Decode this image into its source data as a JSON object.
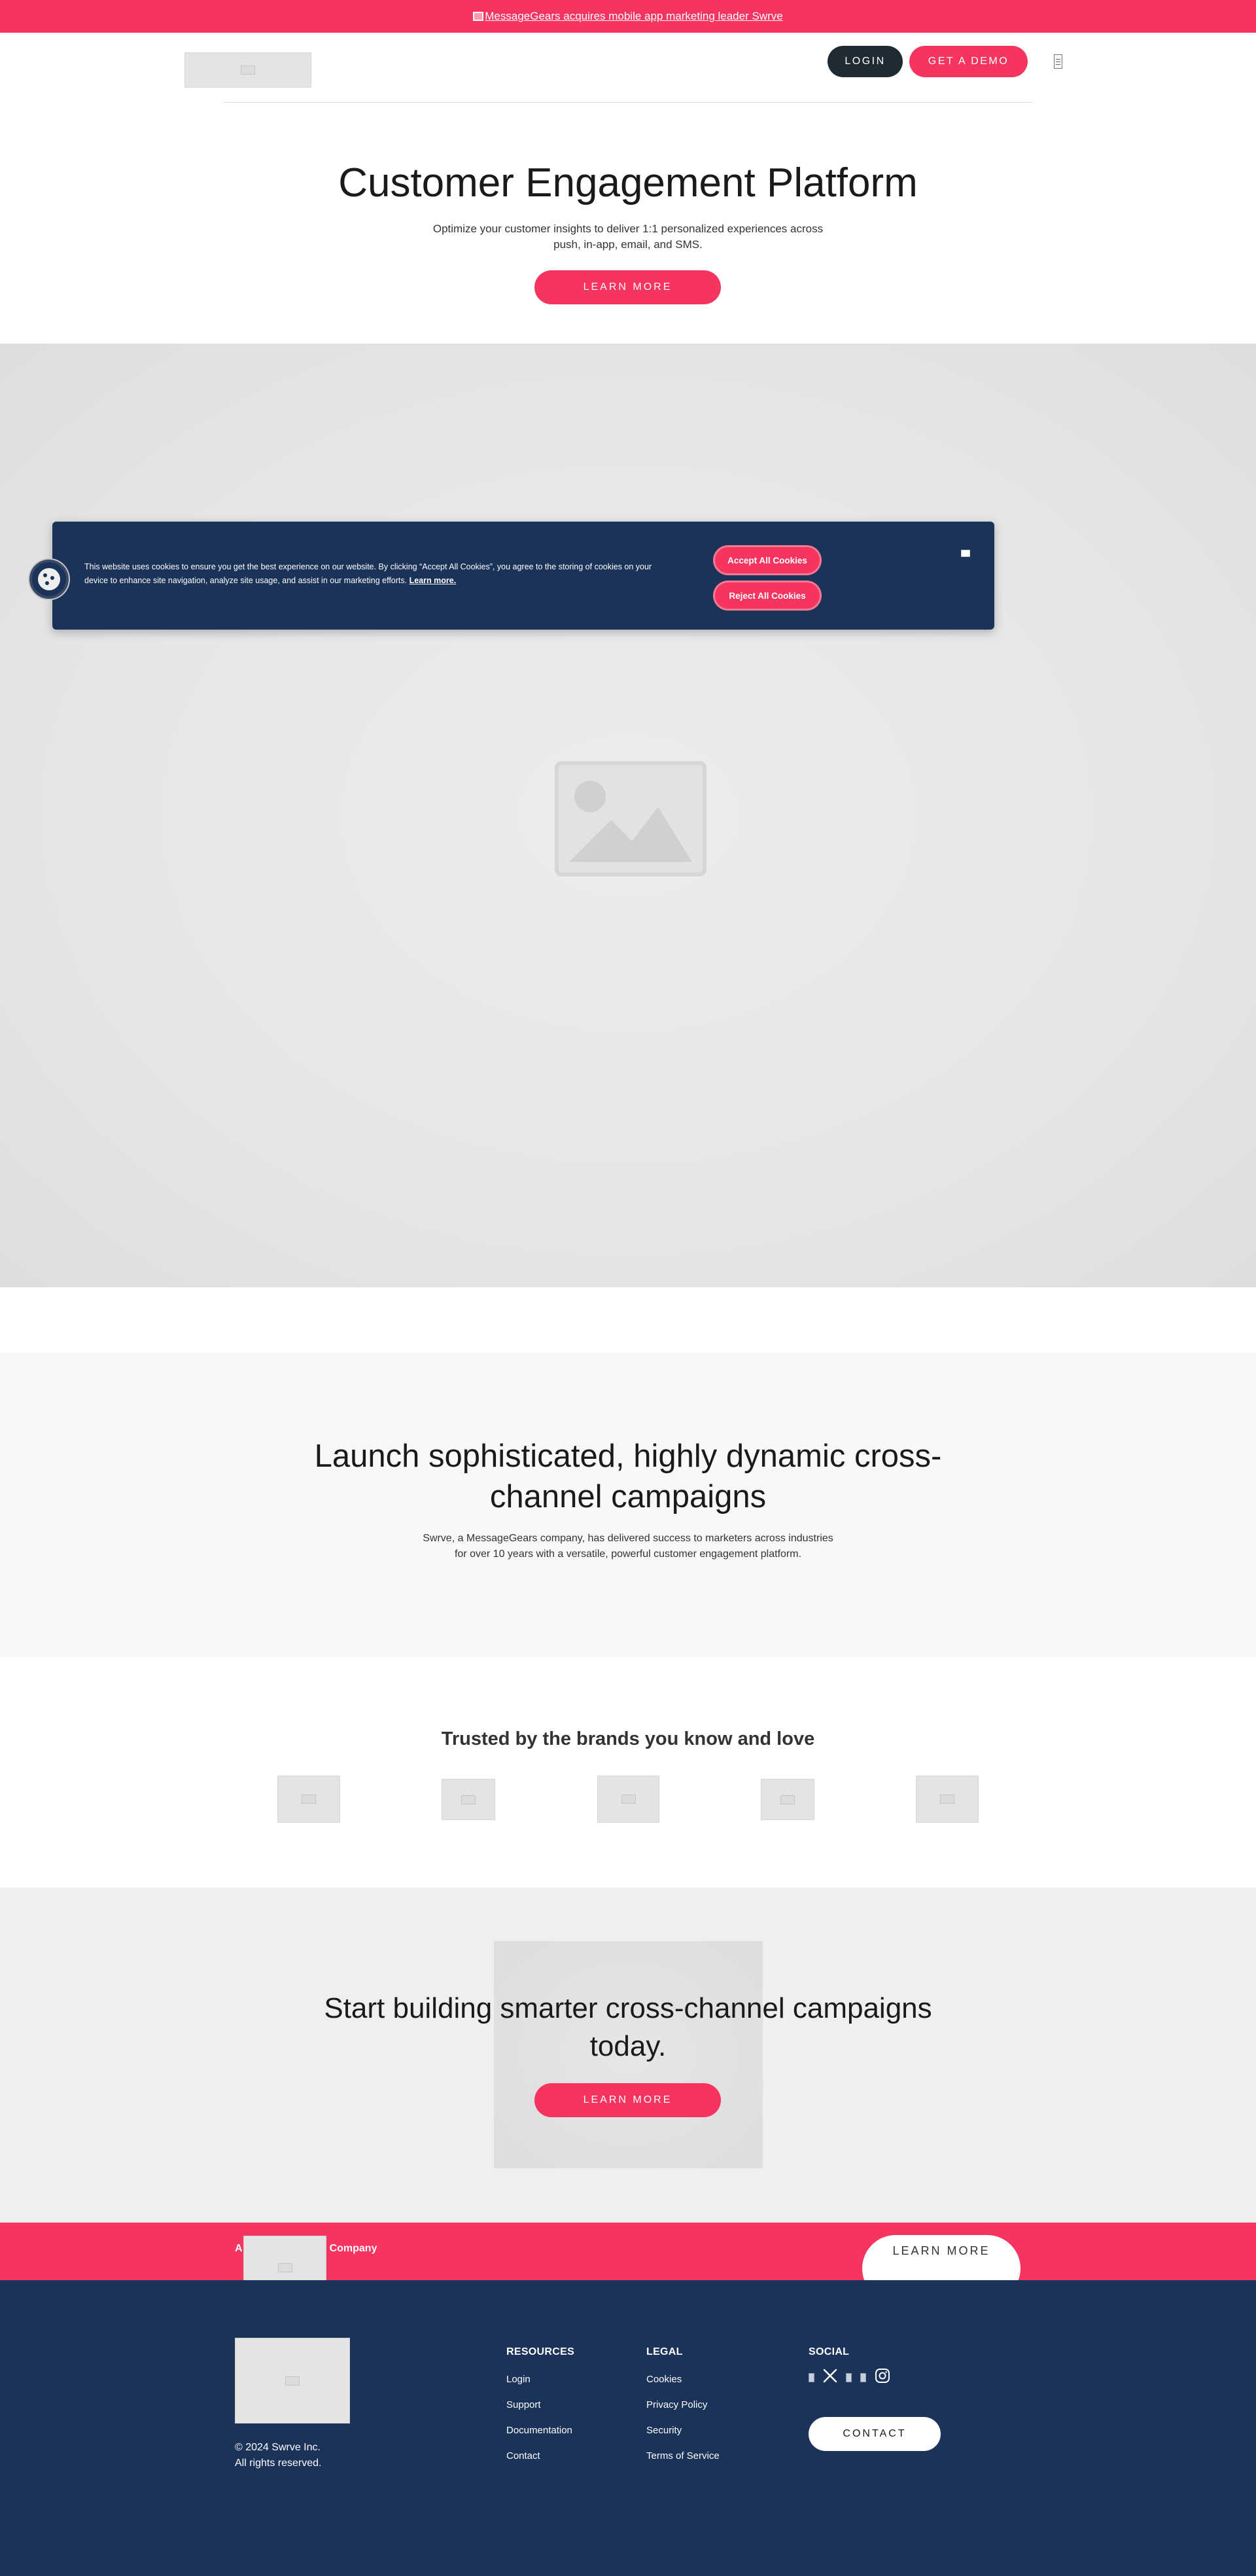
{
  "colors": {
    "brand_pink": "#f5345f",
    "navy": "#1b3259",
    "dark_button": "#1f2a33",
    "light_gray": "#f8f8f8"
  },
  "announcement": {
    "text": "MessageGears acquires mobile app marketing leader Swrve",
    "icon": "image-placeholder-icon"
  },
  "header": {
    "logo_icon": "image-placeholder-icon",
    "login_label": "LOGIN",
    "demo_label": "GET A DEMO",
    "menu_icon": "menu-icon"
  },
  "hero": {
    "title": "Customer Engagement Platform",
    "subtitle": "Optimize your customer insights to deliver 1:1 personalized experiences across push, in-app, email, and SMS.",
    "cta_label": "LEARN MORE",
    "image_icon": "image-placeholder-icon"
  },
  "cookie_banner": {
    "text": "This website uses cookies to ensure you get the best experience on our website. By clicking “Accept All Cookies”, you agree to the storing of cookies on your device to enhance site navigation, analyze site usage, and assist in our marketing efforts.",
    "link_label": "Learn more.",
    "accept_label": "Accept All Cookies",
    "reject_label": "Reject All Cookies",
    "floating_icon": "cookie-icon",
    "close_icon": "close-icon"
  },
  "launch": {
    "title": "Launch sophisticated, highly dynamic cross-channel campaigns",
    "subtitle": "Swrve, a MessageGears company, has delivered success to marketers across industries for over 10 years with a versatile, powerful customer engagement platform."
  },
  "trusted": {
    "title": "Trusted by the brands you know and love",
    "brands": [
      "brand-logo",
      "brand-logo",
      "brand-logo",
      "brand-logo",
      "brand-logo"
    ]
  },
  "start": {
    "title": "Start building smarter cross-channel campaigns today.",
    "cta_label": "LEARN MORE"
  },
  "band": {
    "text_left": "A",
    "text_right": "Company",
    "cta_label": "LEARN MORE"
  },
  "footer": {
    "copyright": "© 2024 Swrve Inc.",
    "rights": "All rights reserved.",
    "resources": {
      "heading": "RESOURCES",
      "links": [
        "Login",
        "Support",
        "Documentation",
        "Contact"
      ]
    },
    "legal": {
      "heading": "LEGAL",
      "links": [
        "Cookies",
        "Privacy Policy",
        "Security",
        "Terms of Service"
      ]
    },
    "social": {
      "heading": "SOCIAL",
      "icons": [
        "linkedin-icon",
        "x-twitter-icon",
        "facebook-icon",
        "youtube-icon",
        "instagram-icon"
      ]
    },
    "contact_label": "CONTACT"
  }
}
